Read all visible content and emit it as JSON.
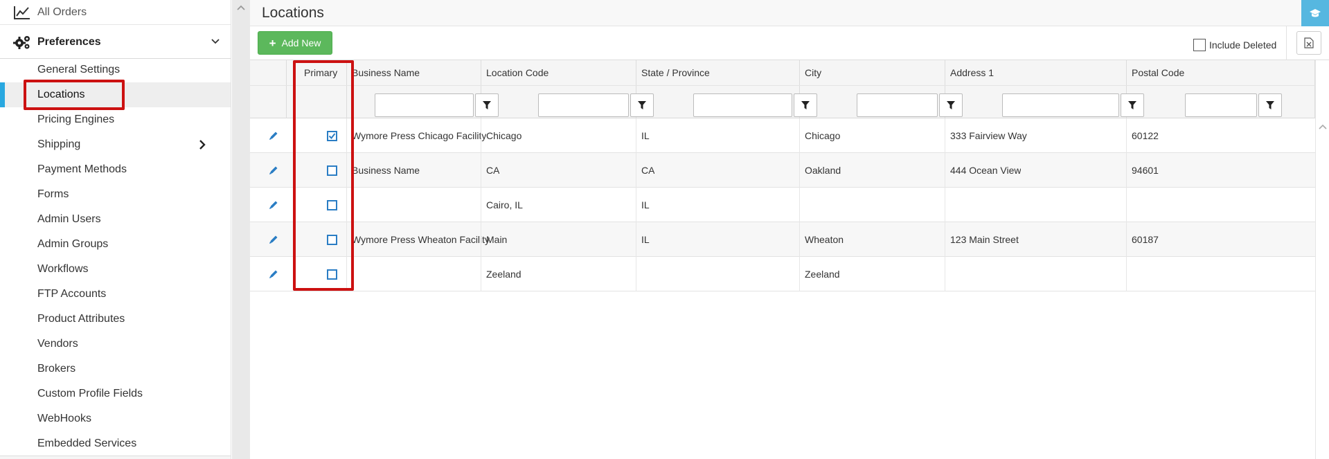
{
  "sidebar": {
    "all_orders": "All Orders",
    "preferences": "Preferences",
    "items": [
      {
        "label": "General Settings"
      },
      {
        "label": "Locations"
      },
      {
        "label": "Pricing Engines"
      },
      {
        "label": "Shipping"
      },
      {
        "label": "Payment Methods"
      },
      {
        "label": "Forms"
      },
      {
        "label": "Admin Users"
      },
      {
        "label": "Admin Groups"
      },
      {
        "label": "Workflows"
      },
      {
        "label": "FTP Accounts"
      },
      {
        "label": "Product Attributes"
      },
      {
        "label": "Vendors"
      },
      {
        "label": "Brokers"
      },
      {
        "label": "Custom Profile Fields"
      },
      {
        "label": "WebHooks"
      },
      {
        "label": "Embedded Services"
      }
    ],
    "active_item": "Locations"
  },
  "page": {
    "title": "Locations"
  },
  "toolbar": {
    "add_new_label": "Add New",
    "include_deleted_label": "Include Deleted",
    "include_deleted_checked": false
  },
  "grid": {
    "columns": {
      "primary": "Primary",
      "business_name": "Business Name",
      "location_code": "Location Code",
      "state": "State / Province",
      "city": "City",
      "address1": "Address 1",
      "postal_code": "Postal Code"
    },
    "rows": [
      {
        "primary": true,
        "business_name": "Wymore Press Chicago Facility",
        "location_code": "Chicago",
        "state": "IL",
        "city": "Chicago",
        "address1": "333 Fairview Way",
        "postal_code": "60122"
      },
      {
        "primary": false,
        "business_name": "Business Name",
        "location_code": "CA",
        "state": "CA",
        "city": "Oakland",
        "address1": "444 Ocean View",
        "postal_code": "94601"
      },
      {
        "primary": false,
        "business_name": "",
        "location_code": "Cairo, IL",
        "state": "IL",
        "city": "",
        "address1": "",
        "postal_code": ""
      },
      {
        "primary": false,
        "business_name": "Wymore Press Wheaton Facility",
        "location_code": "Main",
        "state": "IL",
        "city": "Wheaton",
        "address1": "123 Main Street",
        "postal_code": "60187"
      },
      {
        "primary": false,
        "business_name": "",
        "location_code": "Zeeland",
        "state": "",
        "city": "Zeeland",
        "address1": "",
        "postal_code": ""
      }
    ]
  },
  "colors": {
    "accent_blue": "#29a8e0",
    "add_button_green": "#5cb85c",
    "highlight_red": "#cc1111",
    "checkbox_blue": "#2a7dc4"
  }
}
